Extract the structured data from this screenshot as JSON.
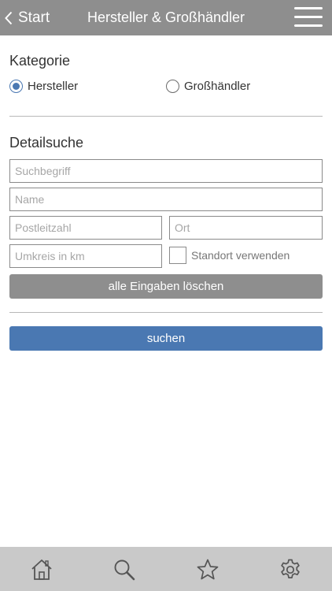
{
  "nav": {
    "back_label": "Start",
    "title": "Hersteller & Großhändler"
  },
  "category": {
    "heading": "Kategorie",
    "options": [
      {
        "label": "Hersteller",
        "selected": true
      },
      {
        "label": "Großhändler",
        "selected": false
      }
    ]
  },
  "details": {
    "heading": "Detailsuche",
    "search_placeholder": "Suchbegriff",
    "name_placeholder": "Name",
    "zip_placeholder": "Postleitzahl",
    "city_placeholder": "Ort",
    "radius_placeholder": "Umkreis in km",
    "use_location_label": "Standort verwenden",
    "use_location_checked": false,
    "clear_label": "alle Eingaben löschen",
    "search_label": "suchen"
  },
  "tabbar": {
    "items": [
      {
        "icon": "home-icon"
      },
      {
        "icon": "search-icon"
      },
      {
        "icon": "star-icon"
      },
      {
        "icon": "gear-icon"
      }
    ]
  },
  "colors": {
    "navbar": "#8e8e8e",
    "accent": "#4a78b2",
    "tabbar": "#c9c9c9"
  }
}
